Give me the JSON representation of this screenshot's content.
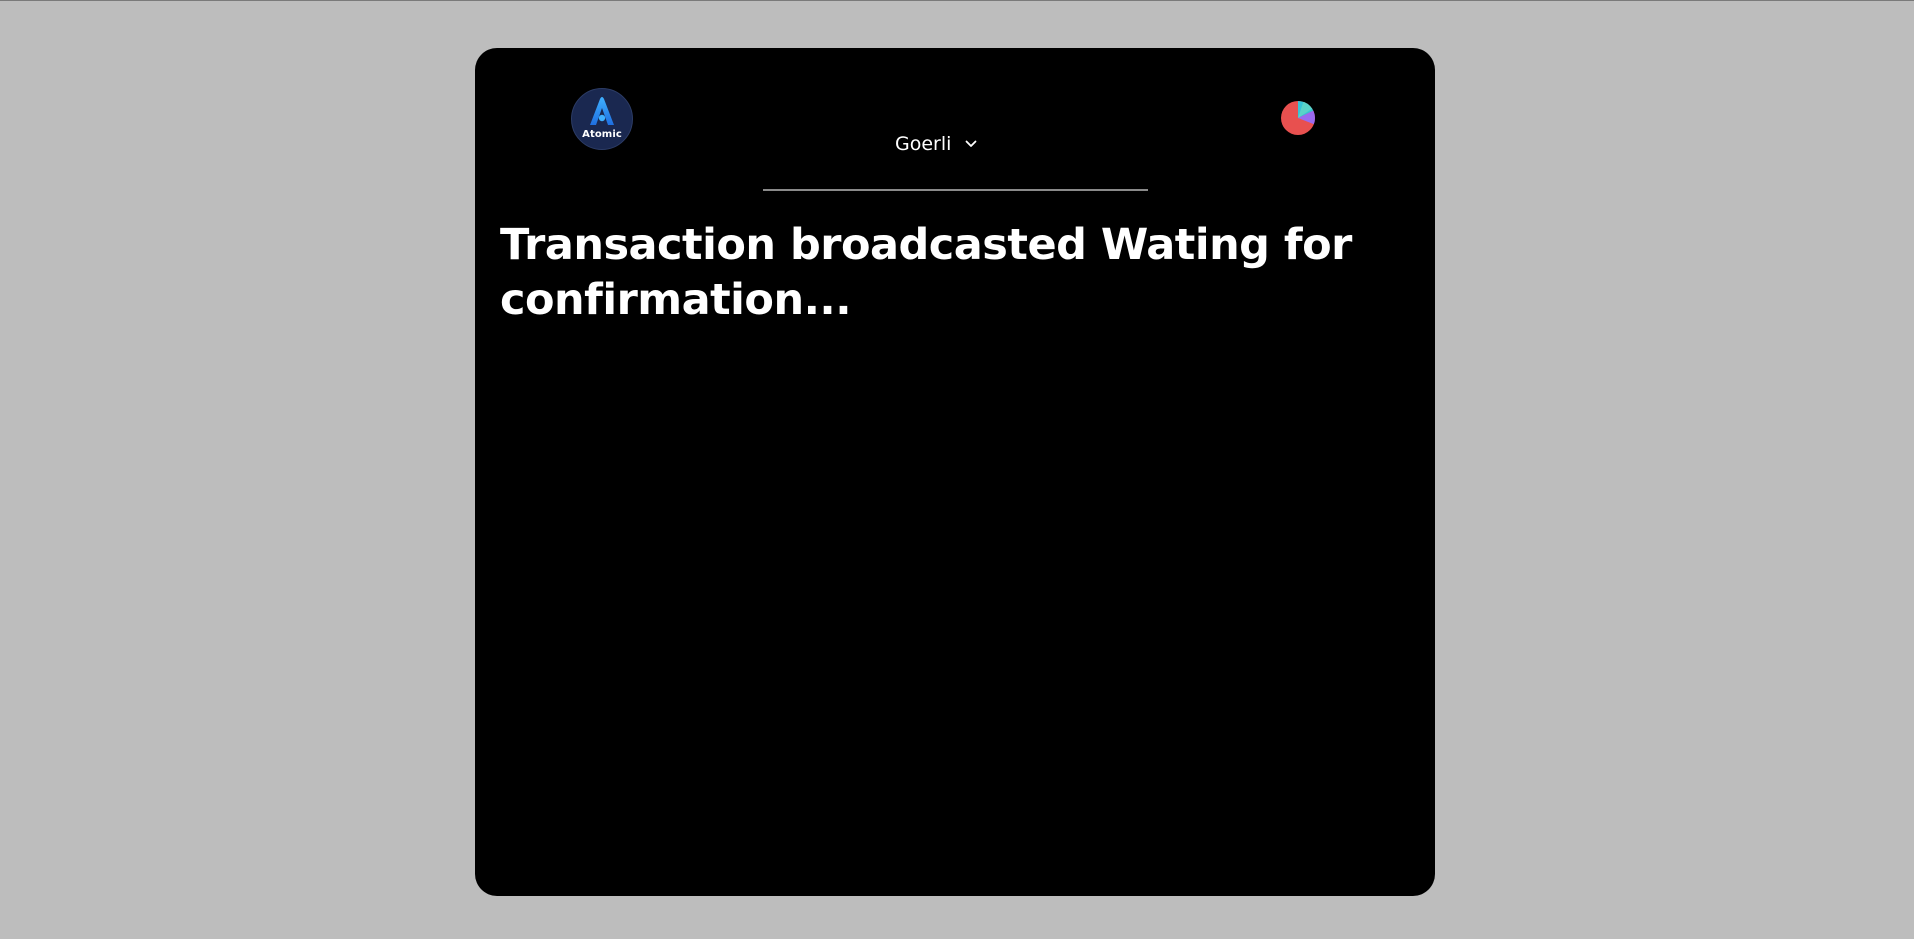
{
  "app": {
    "logo_text": "Atomic",
    "logo_icon": "atomic-a-icon",
    "accent_color": "#2b8cff"
  },
  "header": {
    "network": {
      "selected": "Goerli",
      "icon": "chevron-down-icon"
    },
    "account_avatar": {
      "icon": "jazzicon-avatar",
      "colors": [
        "#e8504f",
        "#37c3d6",
        "#9a6af0"
      ]
    }
  },
  "main": {
    "status_title": "Transaction broadcasted Wating for confirmation..."
  }
}
